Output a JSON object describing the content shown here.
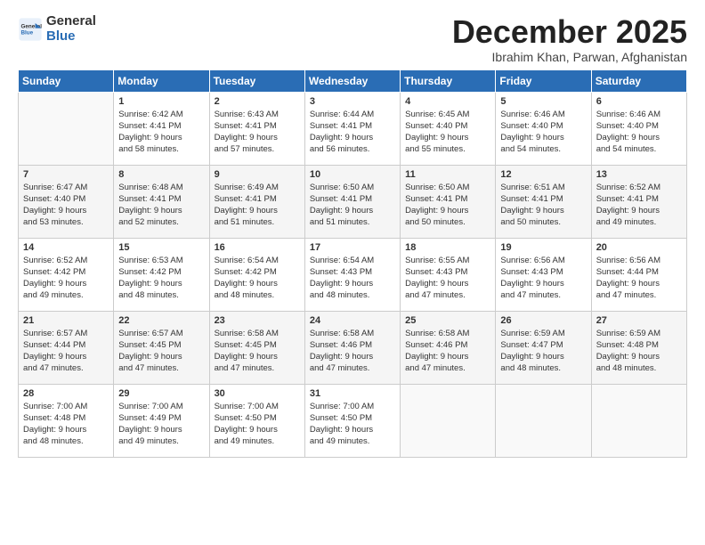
{
  "logo": {
    "general": "General",
    "blue": "Blue"
  },
  "title": "December 2025",
  "subtitle": "Ibrahim Khan, Parwan, Afghanistan",
  "days_header": [
    "Sunday",
    "Monday",
    "Tuesday",
    "Wednesday",
    "Thursday",
    "Friday",
    "Saturday"
  ],
  "weeks": [
    [
      {
        "day": "",
        "info": ""
      },
      {
        "day": "1",
        "info": "Sunrise: 6:42 AM\nSunset: 4:41 PM\nDaylight: 9 hours\nand 58 minutes."
      },
      {
        "day": "2",
        "info": "Sunrise: 6:43 AM\nSunset: 4:41 PM\nDaylight: 9 hours\nand 57 minutes."
      },
      {
        "day": "3",
        "info": "Sunrise: 6:44 AM\nSunset: 4:41 PM\nDaylight: 9 hours\nand 56 minutes."
      },
      {
        "day": "4",
        "info": "Sunrise: 6:45 AM\nSunset: 4:40 PM\nDaylight: 9 hours\nand 55 minutes."
      },
      {
        "day": "5",
        "info": "Sunrise: 6:46 AM\nSunset: 4:40 PM\nDaylight: 9 hours\nand 54 minutes."
      },
      {
        "day": "6",
        "info": "Sunrise: 6:46 AM\nSunset: 4:40 PM\nDaylight: 9 hours\nand 54 minutes."
      }
    ],
    [
      {
        "day": "7",
        "info": "Sunrise: 6:47 AM\nSunset: 4:40 PM\nDaylight: 9 hours\nand 53 minutes."
      },
      {
        "day": "8",
        "info": "Sunrise: 6:48 AM\nSunset: 4:41 PM\nDaylight: 9 hours\nand 52 minutes."
      },
      {
        "day": "9",
        "info": "Sunrise: 6:49 AM\nSunset: 4:41 PM\nDaylight: 9 hours\nand 51 minutes."
      },
      {
        "day": "10",
        "info": "Sunrise: 6:50 AM\nSunset: 4:41 PM\nDaylight: 9 hours\nand 51 minutes."
      },
      {
        "day": "11",
        "info": "Sunrise: 6:50 AM\nSunset: 4:41 PM\nDaylight: 9 hours\nand 50 minutes."
      },
      {
        "day": "12",
        "info": "Sunrise: 6:51 AM\nSunset: 4:41 PM\nDaylight: 9 hours\nand 50 minutes."
      },
      {
        "day": "13",
        "info": "Sunrise: 6:52 AM\nSunset: 4:41 PM\nDaylight: 9 hours\nand 49 minutes."
      }
    ],
    [
      {
        "day": "14",
        "info": "Sunrise: 6:52 AM\nSunset: 4:42 PM\nDaylight: 9 hours\nand 49 minutes."
      },
      {
        "day": "15",
        "info": "Sunrise: 6:53 AM\nSunset: 4:42 PM\nDaylight: 9 hours\nand 48 minutes."
      },
      {
        "day": "16",
        "info": "Sunrise: 6:54 AM\nSunset: 4:42 PM\nDaylight: 9 hours\nand 48 minutes."
      },
      {
        "day": "17",
        "info": "Sunrise: 6:54 AM\nSunset: 4:43 PM\nDaylight: 9 hours\nand 48 minutes."
      },
      {
        "day": "18",
        "info": "Sunrise: 6:55 AM\nSunset: 4:43 PM\nDaylight: 9 hours\nand 47 minutes."
      },
      {
        "day": "19",
        "info": "Sunrise: 6:56 AM\nSunset: 4:43 PM\nDaylight: 9 hours\nand 47 minutes."
      },
      {
        "day": "20",
        "info": "Sunrise: 6:56 AM\nSunset: 4:44 PM\nDaylight: 9 hours\nand 47 minutes."
      }
    ],
    [
      {
        "day": "21",
        "info": "Sunrise: 6:57 AM\nSunset: 4:44 PM\nDaylight: 9 hours\nand 47 minutes."
      },
      {
        "day": "22",
        "info": "Sunrise: 6:57 AM\nSunset: 4:45 PM\nDaylight: 9 hours\nand 47 minutes."
      },
      {
        "day": "23",
        "info": "Sunrise: 6:58 AM\nSunset: 4:45 PM\nDaylight: 9 hours\nand 47 minutes."
      },
      {
        "day": "24",
        "info": "Sunrise: 6:58 AM\nSunset: 4:46 PM\nDaylight: 9 hours\nand 47 minutes."
      },
      {
        "day": "25",
        "info": "Sunrise: 6:58 AM\nSunset: 4:46 PM\nDaylight: 9 hours\nand 47 minutes."
      },
      {
        "day": "26",
        "info": "Sunrise: 6:59 AM\nSunset: 4:47 PM\nDaylight: 9 hours\nand 48 minutes."
      },
      {
        "day": "27",
        "info": "Sunrise: 6:59 AM\nSunset: 4:48 PM\nDaylight: 9 hours\nand 48 minutes."
      }
    ],
    [
      {
        "day": "28",
        "info": "Sunrise: 7:00 AM\nSunset: 4:48 PM\nDaylight: 9 hours\nand 48 minutes."
      },
      {
        "day": "29",
        "info": "Sunrise: 7:00 AM\nSunset: 4:49 PM\nDaylight: 9 hours\nand 49 minutes."
      },
      {
        "day": "30",
        "info": "Sunrise: 7:00 AM\nSunset: 4:50 PM\nDaylight: 9 hours\nand 49 minutes."
      },
      {
        "day": "31",
        "info": "Sunrise: 7:00 AM\nSunset: 4:50 PM\nDaylight: 9 hours\nand 49 minutes."
      },
      {
        "day": "",
        "info": ""
      },
      {
        "day": "",
        "info": ""
      },
      {
        "day": "",
        "info": ""
      }
    ]
  ]
}
